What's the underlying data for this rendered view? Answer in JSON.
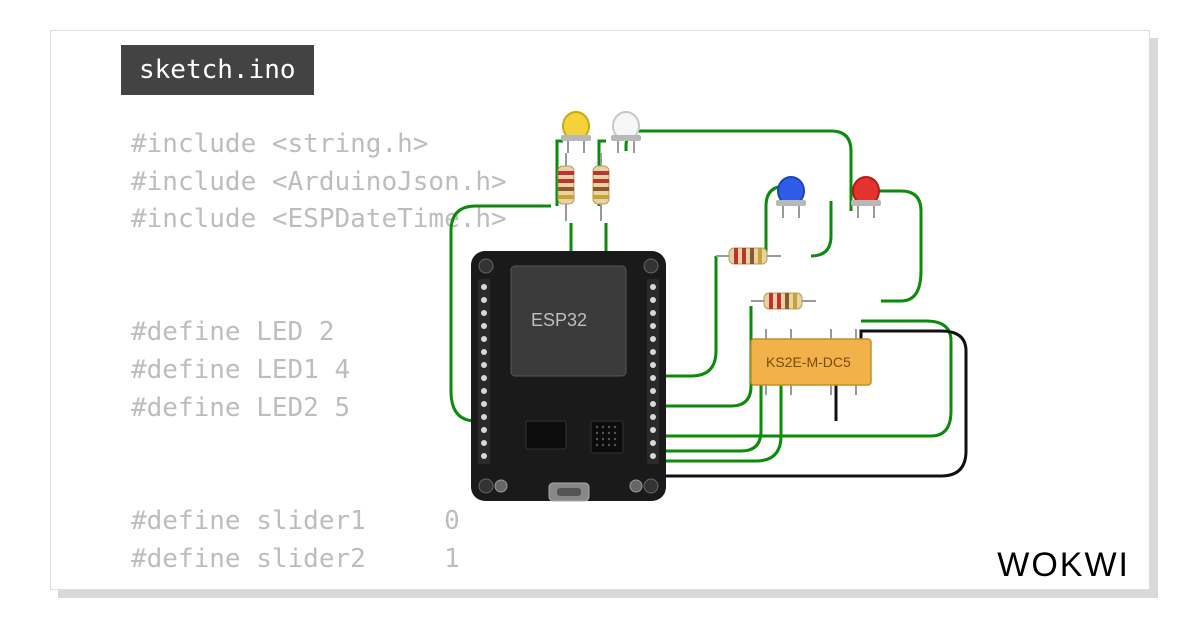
{
  "tab_label": "sketch.ino",
  "code_lines": "#include <string.h>\n#include <ArduinoJson.h>\n#include <ESPDateTime.h>\n\n\n#define LED 2\n#define LED1 4\n#define LED2 5\n\n\n#define slider1     0\n#define slider2     1",
  "board_label": "ESP32",
  "relay_label": "KS2E-M-DC5",
  "brand": "WOKWI",
  "leds": [
    {
      "name": "led-yellow",
      "color": "#f4d33a"
    },
    {
      "name": "led-white",
      "color": "#f4f4f4"
    },
    {
      "name": "led-blue",
      "color": "#2d5de8"
    },
    {
      "name": "led-red",
      "color": "#e2332e"
    }
  ],
  "wire_color": "#0a8b0a",
  "wire_color_black": "#111"
}
